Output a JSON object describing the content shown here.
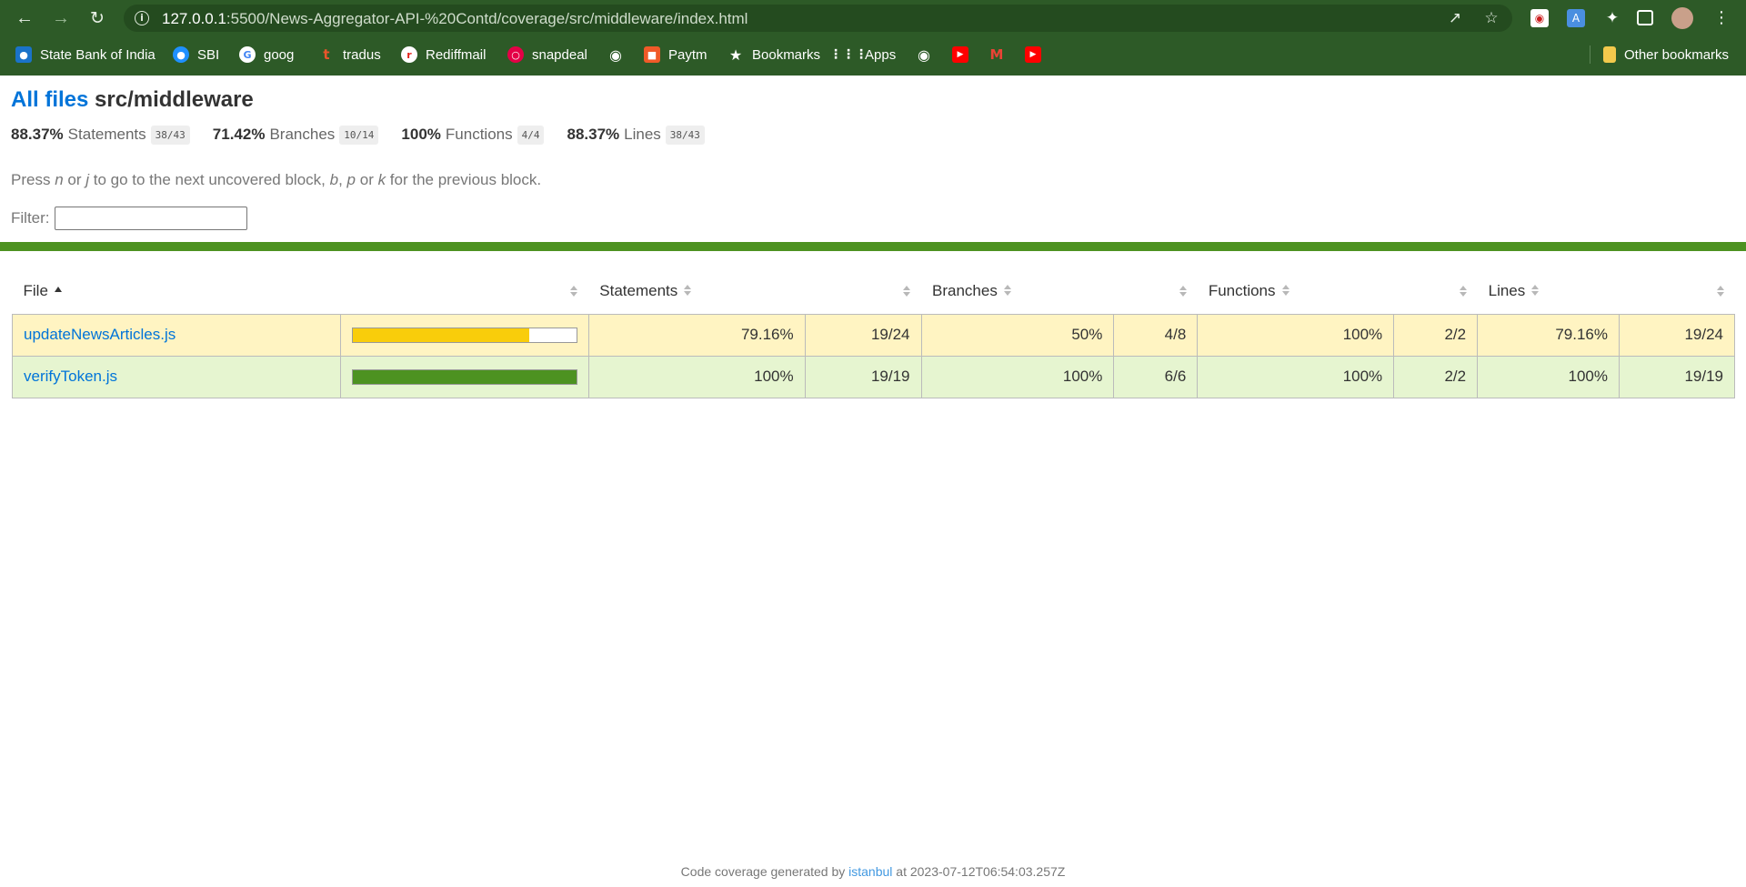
{
  "browser": {
    "url_host": "127.0.0.1",
    "url_rest": ":5500/News-Aggregator-API-%20Contd/coverage/src/middleware/index.html",
    "bookmarks": [
      {
        "label": "State Bank of India",
        "icon": "sbi-bank-icon",
        "color": "#1a73c9"
      },
      {
        "label": "SBI",
        "icon": "sbi-icon",
        "color": "#1e90ff"
      },
      {
        "label": "goog",
        "icon": "google-icon",
        "color": "#ffffff"
      },
      {
        "label": "tradus",
        "icon": "tradus-icon",
        "color": "#e8552b"
      },
      {
        "label": "Rediffmail",
        "icon": "rediffmail-icon",
        "color": "#e2231a"
      },
      {
        "label": "snapdeal",
        "icon": "snapdeal-icon",
        "color": "#e40046"
      },
      {
        "label": "",
        "icon": "globe-icon",
        "color": "#ffffff"
      },
      {
        "label": "Paytm",
        "icon": "paytm-icon",
        "color": "#f05a28"
      },
      {
        "label": "Bookmarks",
        "icon": "star-icon",
        "color": "#ffffff"
      },
      {
        "label": "Apps",
        "icon": "apps-grid-icon",
        "color": "#ffffff"
      },
      {
        "label": "",
        "icon": "globe-icon",
        "color": "#ffffff"
      },
      {
        "label": "",
        "icon": "youtube-icon",
        "color": "#ff0000"
      },
      {
        "label": "",
        "icon": "gmail-icon",
        "color": "#ea4335"
      },
      {
        "label": "",
        "icon": "youtube-icon",
        "color": "#ff0000"
      }
    ],
    "other_bookmarks": "Other bookmarks"
  },
  "header": {
    "all_files": "All files",
    "path": "src/middleware"
  },
  "summary": [
    {
      "pct": "88.37%",
      "label": "Statements",
      "frac": "38/43"
    },
    {
      "pct": "71.42%",
      "label": "Branches",
      "frac": "10/14"
    },
    {
      "pct": "100%",
      "label": "Functions",
      "frac": "4/4"
    },
    {
      "pct": "88.37%",
      "label": "Lines",
      "frac": "38/43"
    }
  ],
  "hint": {
    "p1": "Press ",
    "k1": "n",
    "p2": " or ",
    "k2": "j",
    "p3": " to go to the next uncovered block, ",
    "k3": "b",
    "p4": ", ",
    "k4": "p",
    "p5": " or ",
    "k5": "k",
    "p6": " for the previous block."
  },
  "filter": {
    "label": "Filter:",
    "value": ""
  },
  "table": {
    "headers": {
      "file": "File",
      "statements": "Statements",
      "branches": "Branches",
      "functions": "Functions",
      "lines": "Lines"
    },
    "rows": [
      {
        "file": "updateNewsArticles.js",
        "coverage": 79.16,
        "level": "medium",
        "statements": "79.16%",
        "statements_frac": "19/24",
        "branches": "50%",
        "branches_frac": "4/8",
        "functions": "100%",
        "functions_frac": "2/2",
        "lines": "79.16%",
        "lines_frac": "19/24"
      },
      {
        "file": "verifyToken.js",
        "coverage": 100,
        "level": "high",
        "statements": "100%",
        "statements_frac": "19/19",
        "branches": "100%",
        "branches_frac": "6/6",
        "functions": "100%",
        "functions_frac": "2/2",
        "lines": "100%",
        "lines_frac": "19/19"
      }
    ]
  },
  "colors": {
    "medium_bar": "#f9cd0b",
    "high_bar": "#4d9221",
    "status_line": "#4d9221",
    "link": "#0074d9"
  },
  "footer": {
    "prefix": "Code coverage generated by",
    "link": "istanbul",
    "suffix": "at 2023-07-12T06:54:03.257Z"
  }
}
